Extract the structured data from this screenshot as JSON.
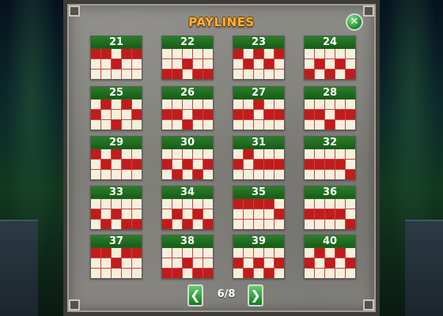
{
  "title": "PAYLINES",
  "close_glyph": "✕",
  "colors": {
    "card_header": "#1d6a1d",
    "cell_empty": "#f6efdc",
    "cell_active": "#c21b1b",
    "title": "#f2b53a"
  },
  "icons": {
    "close": "close-icon",
    "prev": "chevron-left-icon",
    "next": "chevron-right-icon"
  },
  "pagination": {
    "prev_glyph": "❮",
    "next_glyph": "❯",
    "label": "6/8"
  },
  "paylines": [
    {
      "number": "21",
      "rows": [
        [
          1,
          1,
          0,
          1,
          1
        ],
        [
          0,
          0,
          1,
          0,
          0
        ],
        [
          0,
          0,
          0,
          0,
          0
        ]
      ]
    },
    {
      "number": "22",
      "rows": [
        [
          0,
          0,
          0,
          0,
          0
        ],
        [
          0,
          0,
          1,
          0,
          0
        ],
        [
          1,
          1,
          0,
          1,
          1
        ]
      ]
    },
    {
      "number": "23",
      "rows": [
        [
          1,
          0,
          1,
          0,
          1
        ],
        [
          0,
          1,
          0,
          1,
          0
        ],
        [
          0,
          0,
          0,
          0,
          0
        ]
      ]
    },
    {
      "number": "24",
      "rows": [
        [
          0,
          0,
          0,
          0,
          0
        ],
        [
          0,
          1,
          0,
          1,
          0
        ],
        [
          1,
          0,
          1,
          0,
          1
        ]
      ]
    },
    {
      "number": "25",
      "rows": [
        [
          0,
          1,
          0,
          1,
          0
        ],
        [
          1,
          0,
          0,
          0,
          1
        ],
        [
          0,
          0,
          1,
          0,
          0
        ]
      ]
    },
    {
      "number": "26",
      "rows": [
        [
          0,
          0,
          0,
          0,
          0
        ],
        [
          1,
          1,
          0,
          1,
          1
        ],
        [
          0,
          0,
          1,
          0,
          0
        ]
      ]
    },
    {
      "number": "27",
      "rows": [
        [
          0,
          0,
          1,
          0,
          0
        ],
        [
          1,
          1,
          0,
          1,
          1
        ],
        [
          0,
          0,
          0,
          0,
          0
        ]
      ]
    },
    {
      "number": "28",
      "rows": [
        [
          0,
          0,
          0,
          0,
          0
        ],
        [
          1,
          1,
          0,
          1,
          1
        ],
        [
          0,
          0,
          1,
          0,
          0
        ]
      ]
    },
    {
      "number": "29",
      "rows": [
        [
          1,
          0,
          1,
          0,
          0
        ],
        [
          0,
          1,
          0,
          1,
          1
        ],
        [
          0,
          0,
          0,
          0,
          0
        ]
      ]
    },
    {
      "number": "30",
      "rows": [
        [
          0,
          0,
          0,
          0,
          0
        ],
        [
          1,
          0,
          1,
          0,
          1
        ],
        [
          0,
          1,
          0,
          1,
          0
        ]
      ]
    },
    {
      "number": "31",
      "rows": [
        [
          0,
          1,
          0,
          0,
          0
        ],
        [
          1,
          0,
          1,
          1,
          1
        ],
        [
          0,
          0,
          0,
          0,
          0
        ]
      ]
    },
    {
      "number": "32",
      "rows": [
        [
          0,
          0,
          0,
          0,
          0
        ],
        [
          1,
          1,
          1,
          1,
          0
        ],
        [
          0,
          0,
          0,
          0,
          1
        ]
      ]
    },
    {
      "number": "33",
      "rows": [
        [
          0,
          0,
          0,
          0,
          0
        ],
        [
          1,
          0,
          1,
          0,
          0
        ],
        [
          0,
          1,
          0,
          1,
          1
        ]
      ]
    },
    {
      "number": "34",
      "rows": [
        [
          0,
          0,
          0,
          0,
          0
        ],
        [
          0,
          1,
          0,
          1,
          0
        ],
        [
          1,
          0,
          1,
          0,
          1
        ]
      ]
    },
    {
      "number": "35",
      "rows": [
        [
          1,
          1,
          1,
          1,
          0
        ],
        [
          0,
          0,
          0,
          0,
          1
        ],
        [
          0,
          0,
          0,
          0,
          0
        ]
      ]
    },
    {
      "number": "36",
      "rows": [
        [
          0,
          0,
          0,
          0,
          0
        ],
        [
          1,
          1,
          1,
          1,
          0
        ],
        [
          0,
          0,
          0,
          0,
          1
        ]
      ]
    },
    {
      "number": "37",
      "rows": [
        [
          1,
          1,
          0,
          1,
          1
        ],
        [
          0,
          0,
          1,
          0,
          0
        ],
        [
          0,
          0,
          0,
          0,
          0
        ]
      ]
    },
    {
      "number": "38",
      "rows": [
        [
          0,
          0,
          0,
          0,
          0
        ],
        [
          0,
          0,
          1,
          0,
          0
        ],
        [
          1,
          1,
          0,
          1,
          1
        ]
      ]
    },
    {
      "number": "39",
      "rows": [
        [
          0,
          0,
          0,
          0,
          0
        ],
        [
          1,
          0,
          1,
          0,
          1
        ],
        [
          0,
          1,
          0,
          1,
          0
        ]
      ]
    },
    {
      "number": "40",
      "rows": [
        [
          0,
          1,
          0,
          1,
          0
        ],
        [
          1,
          0,
          1,
          0,
          1
        ],
        [
          0,
          0,
          0,
          0,
          0
        ]
      ]
    }
  ]
}
